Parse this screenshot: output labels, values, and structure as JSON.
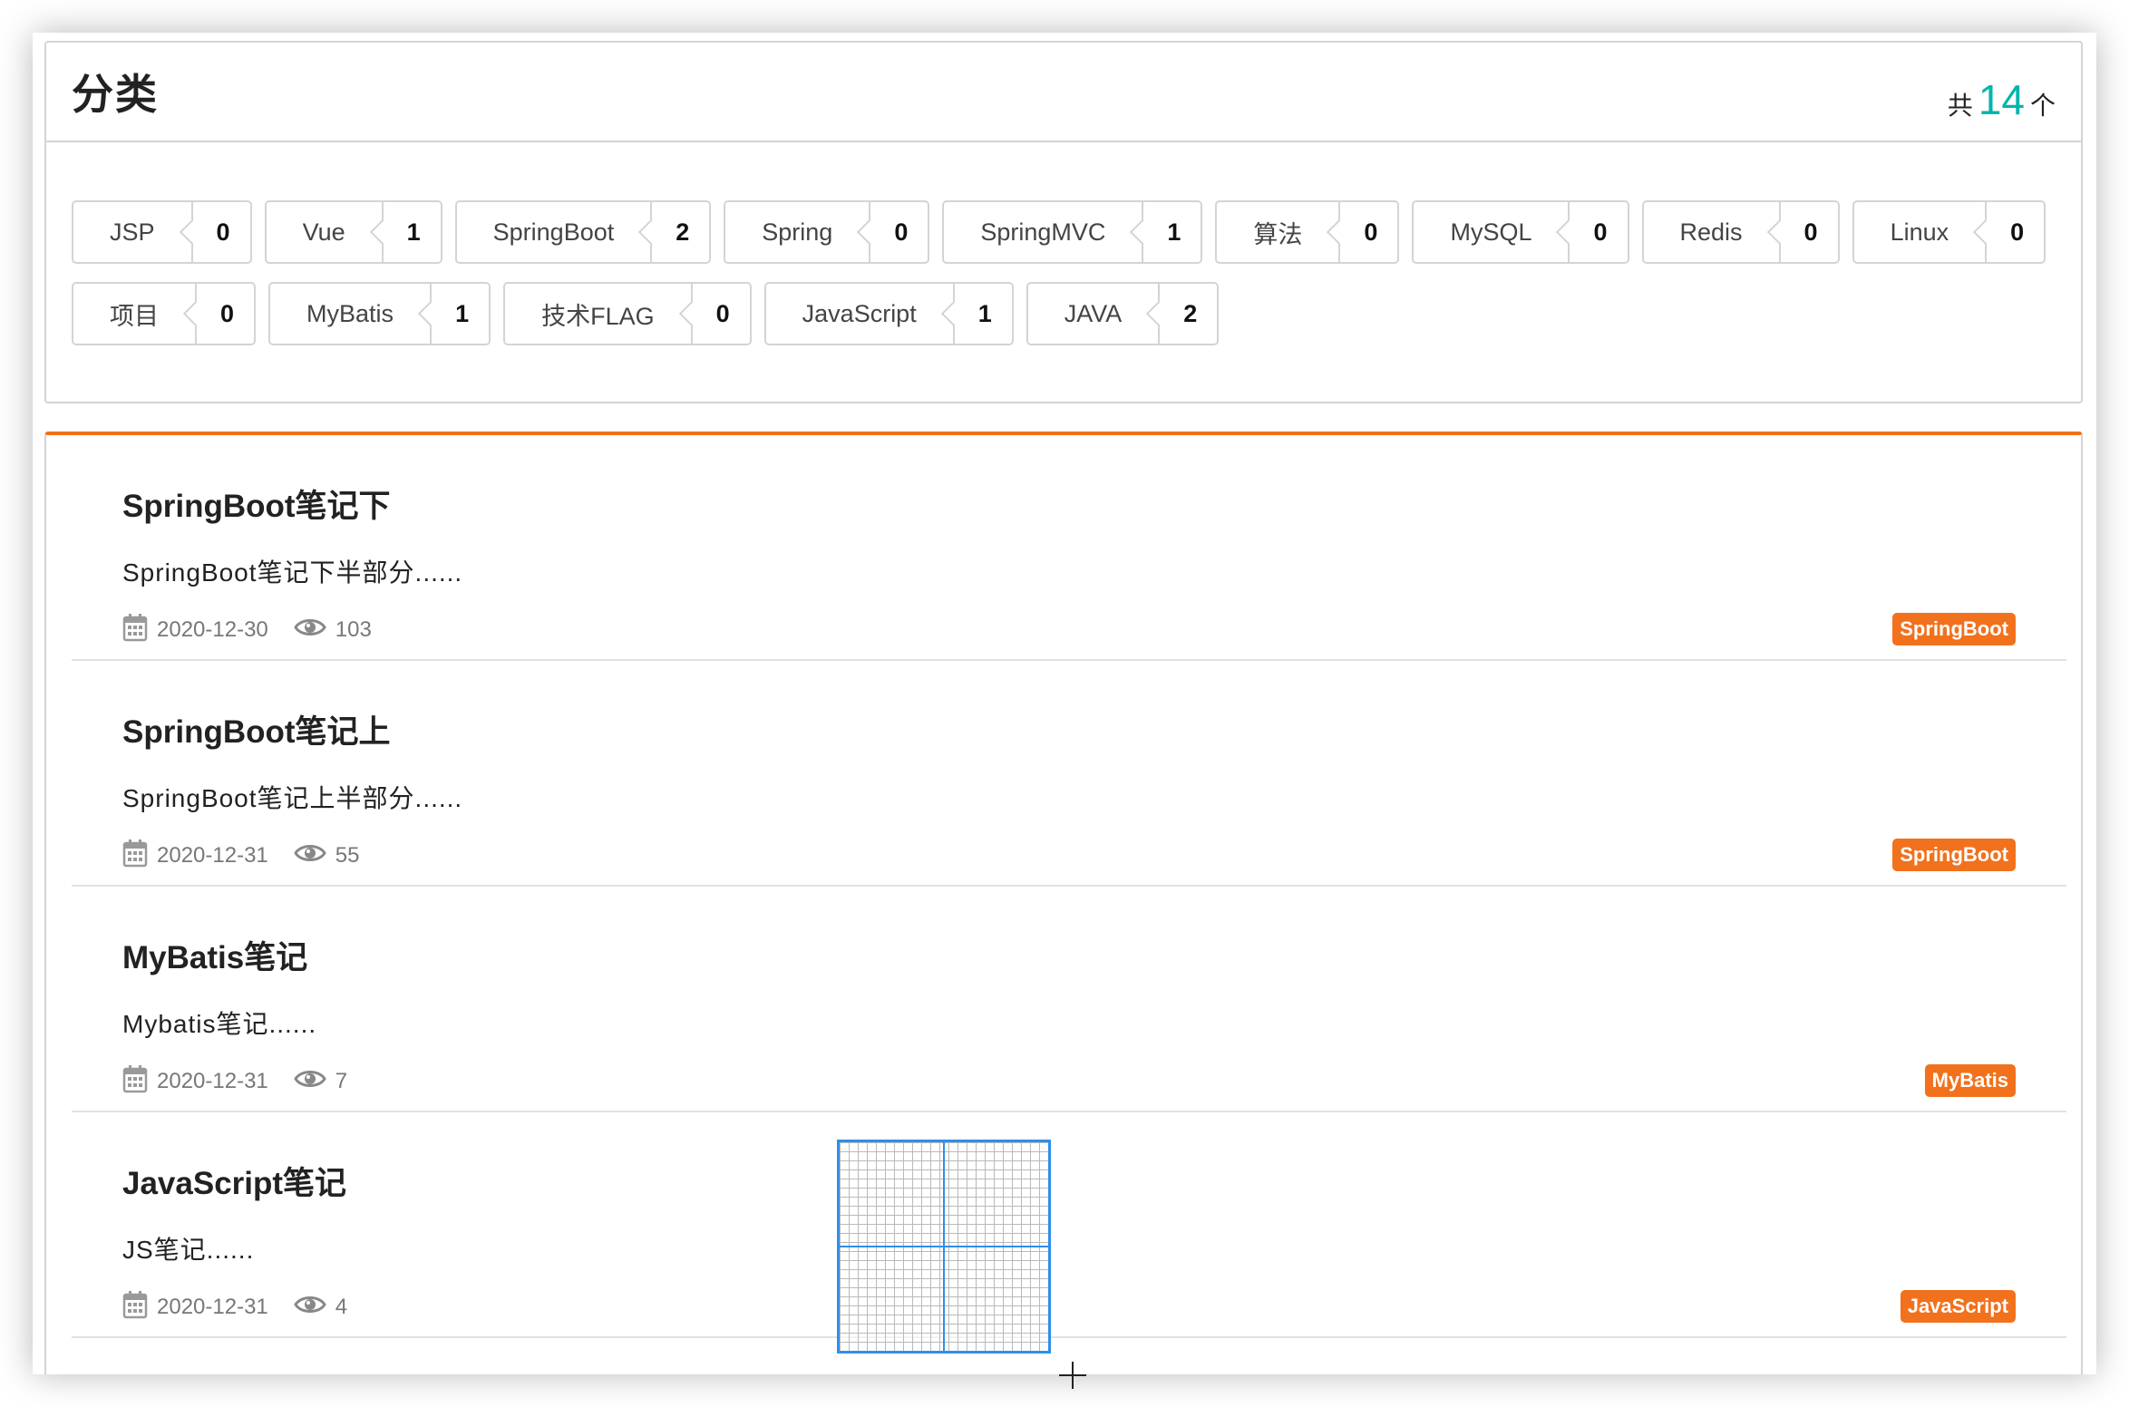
{
  "categories": {
    "title": "分类",
    "count_prefix": "共",
    "count_value": "14",
    "count_suffix": "个",
    "items": [
      {
        "name": "JSP",
        "count": "0"
      },
      {
        "name": "Vue",
        "count": "1"
      },
      {
        "name": "SpringBoot",
        "count": "2"
      },
      {
        "name": "Spring",
        "count": "0"
      },
      {
        "name": "SpringMVC",
        "count": "1"
      },
      {
        "name": "算法",
        "count": "0"
      },
      {
        "name": "MySQL",
        "count": "0"
      },
      {
        "name": "Redis",
        "count": "0"
      },
      {
        "name": "Linux",
        "count": "0"
      },
      {
        "name": "项目",
        "count": "0"
      },
      {
        "name": "MyBatis",
        "count": "1"
      },
      {
        "name": "技术FLAG",
        "count": "0"
      },
      {
        "name": "JavaScript",
        "count": "1"
      },
      {
        "name": "JAVA",
        "count": "2"
      }
    ]
  },
  "blogs": [
    {
      "title": "SpringBoot笔记下",
      "desc": "SpringBoot笔记下半部分......",
      "date": "2020-12-30",
      "views": "103",
      "tag": "SpringBoot"
    },
    {
      "title": "SpringBoot笔记上",
      "desc": "SpringBoot笔记上半部分......",
      "date": "2020-12-31",
      "views": "55",
      "tag": "SpringBoot"
    },
    {
      "title": "MyBatis笔记",
      "desc": "Mybatis笔记......",
      "date": "2020-12-31",
      "views": "7",
      "tag": "MyBatis"
    },
    {
      "title": "JavaScript笔记",
      "desc": "JS笔记......",
      "date": "2020-12-31",
      "views": "4",
      "tag": "JavaScript"
    }
  ],
  "icons": {
    "date": "calendar-icon",
    "views": "eye-icon"
  },
  "colors": {
    "accent_teal": "#00b5ad",
    "accent_orange": "#f2711c",
    "overlay_blue": "#2f8fea"
  }
}
